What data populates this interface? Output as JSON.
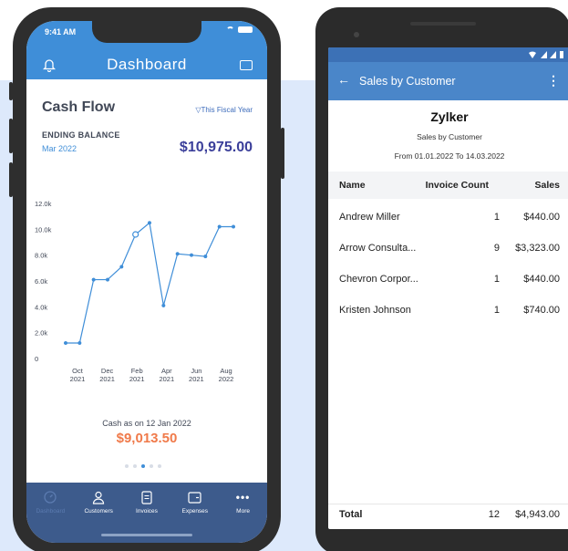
{
  "iphone": {
    "status_time": "9:41 AM",
    "header_title": "Dashboard",
    "card_title": "Cash Flow",
    "filter_label": "This Fiscal Year",
    "ending_balance_label": "ENDING BALANCE",
    "ending_balance_date": "Mar 2022",
    "ending_balance_amount": "$10,975.00",
    "cash_label": "Cash as on 12 Jan 2022",
    "cash_amount": "$9,013.50",
    "tabs": [
      {
        "label": "Dashboard",
        "icon": "dashboard-icon",
        "active": true
      },
      {
        "label": "Customers",
        "icon": "person-icon",
        "active": false
      },
      {
        "label": "Invoices",
        "icon": "document-icon",
        "active": false
      },
      {
        "label": "Expenses",
        "icon": "wallet-icon",
        "active": false
      },
      {
        "label": "More",
        "icon": "more-icon",
        "active": false
      }
    ],
    "colors": {
      "header": "#3f8ed8",
      "tabbar": "#3d5b8c",
      "accent_orange": "#f07a4a",
      "balance": "#3b3f9a"
    }
  },
  "chart_data": {
    "type": "line",
    "y_ticks": [
      "0",
      "2.0k",
      "4.0k",
      "6.0k",
      "8.0k",
      "10.0k",
      "12.0k"
    ],
    "x_ticks": [
      [
        "Oct",
        "2021"
      ],
      [
        "Dec",
        "2021"
      ],
      [
        "Feb",
        "2021"
      ],
      [
        "Apr",
        "2021"
      ],
      [
        "Jun",
        "2021"
      ],
      [
        "Aug",
        "2022"
      ]
    ],
    "values": [
      1200,
      1200,
      6100,
      6100,
      7100,
      9600,
      10500,
      4100,
      8100,
      8000,
      7900,
      10200,
      10200
    ],
    "highlight_index": 5,
    "ylim": [
      0,
      12000
    ],
    "line_color": "#3f8ed8"
  },
  "android": {
    "toolbar_title": "Sales by Customer",
    "org_name": "Zylker",
    "report_subtitle": "Sales by Customer",
    "report_range": "From 01.01.2022 To 14.03.2022",
    "columns": {
      "name": "Name",
      "count": "Invoice Count",
      "sales": "Sales"
    },
    "rows": [
      {
        "name": "Andrew Miller",
        "count": "1",
        "sales": "$440.00"
      },
      {
        "name": "Arrow Consulta...",
        "count": "9",
        "sales": "$3,323.00"
      },
      {
        "name": "Chevron Corpor...",
        "count": "1",
        "sales": "$440.00"
      },
      {
        "name": "Kristen Johnson",
        "count": "1",
        "sales": "$740.00"
      }
    ],
    "total": {
      "name": "Total",
      "count": "12",
      "sales": "$4,943.00"
    },
    "colors": {
      "toolbar": "#4a86c9",
      "status": "#3c71b6"
    }
  }
}
